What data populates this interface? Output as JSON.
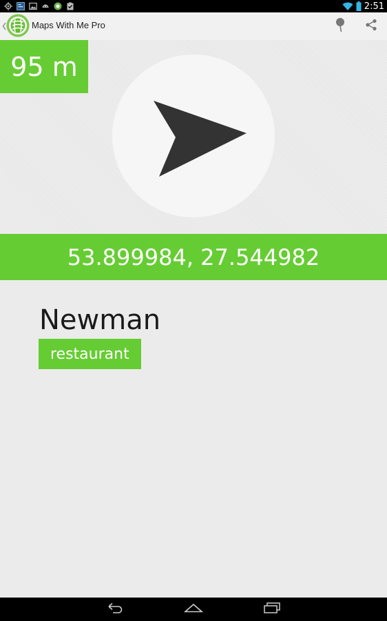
{
  "status_bar": {
    "time": "2:51",
    "icons": [
      "gps-icon",
      "notification-icon",
      "image-icon",
      "android-icon",
      "app-icon",
      "clipboard-check-icon",
      "wifi-icon",
      "battery-icon"
    ]
  },
  "action_bar": {
    "title": "Maps With Me Pro",
    "actions": [
      "pin-icon",
      "share-icon"
    ]
  },
  "compass": {
    "distance": "95 m"
  },
  "location": {
    "coordinates": "53.899984, 27.544982"
  },
  "place": {
    "name": "Newman",
    "type": "restaurant"
  },
  "navigation": {
    "buttons": [
      "back-icon",
      "home-icon",
      "recents-icon"
    ]
  },
  "colors": {
    "accent": "#66cc33",
    "background": "#ebebeb",
    "arrow": "#333333"
  }
}
